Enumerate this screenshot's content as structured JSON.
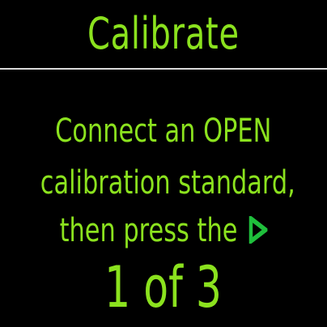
{
  "header": {
    "title": "Calibrate"
  },
  "instruction": {
    "line1": "Connect an OPEN",
    "line2": "calibration standard,",
    "line3": "then press the",
    "action_icon": "play-icon"
  },
  "progress": {
    "label": "1 of 3",
    "current": 1,
    "total": 3
  },
  "colors": {
    "background": "#000000",
    "text": "#8BE21E",
    "icon": "#1FBF3C",
    "divider": "#D9D9D9"
  }
}
